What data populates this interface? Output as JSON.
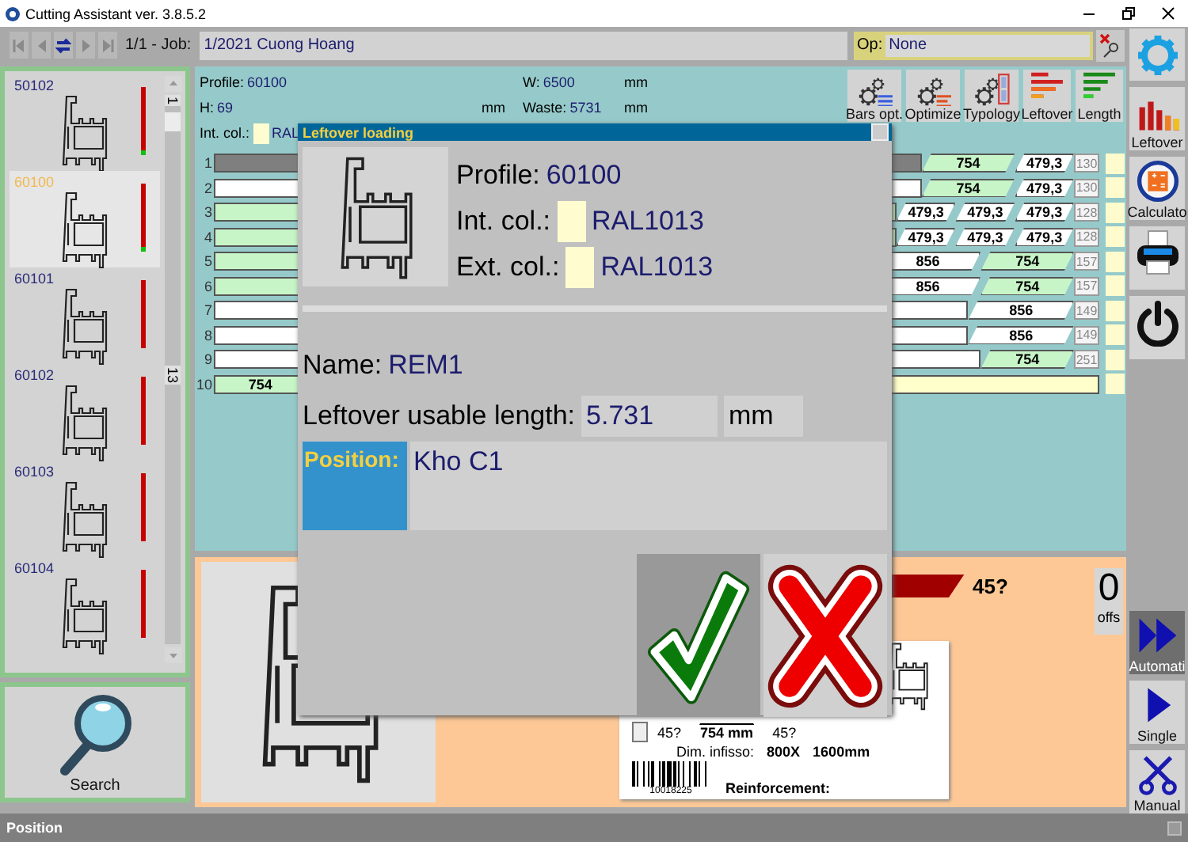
{
  "window": {
    "title": "Cutting Assistant ver. 3.8.5.2"
  },
  "toolbar": {
    "nav": [
      {
        "kind": "first",
        "disabled": true
      },
      {
        "kind": "prev",
        "disabled": true
      },
      {
        "kind": "swap",
        "disabled": false
      },
      {
        "kind": "next",
        "disabled": true
      },
      {
        "kind": "last",
        "disabled": true
      }
    ],
    "job_label": "1/1 - Job:",
    "job": "1/2021 Cuong Hoang",
    "op_label": "Op:",
    "op": "None"
  },
  "profiles": {
    "items": [
      {
        "code": "50102",
        "selected": false,
        "level": 0.06
      },
      {
        "code": "60100",
        "selected": true,
        "level": 0.06
      },
      {
        "code": "60101",
        "selected": false,
        "level": 0
      },
      {
        "code": "60102",
        "selected": false,
        "level": 0
      },
      {
        "code": "60103",
        "selected": false,
        "level": 0
      },
      {
        "code": "60104",
        "selected": false,
        "level": 0
      }
    ],
    "scroll_top_label": "1",
    "scroll_mid_label": "13",
    "search": "Search"
  },
  "bars": {
    "header": {
      "profile": {
        "label": "Profile:",
        "value": "60100"
      },
      "w": {
        "label": "W:",
        "value": "6500",
        "unit": "mm"
      },
      "h": {
        "label": "H:",
        "value": "69",
        "unit": "mm"
      },
      "waste": {
        "label": "Waste:",
        "value": "5731",
        "unit": "mm"
      },
      "int_col": {
        "label": "Int. col.:",
        "value": "RAL",
        "color": "#fffdd0"
      }
    },
    "tools": [
      {
        "kind": "bars",
        "label": "Bars opt."
      },
      {
        "kind": "optimize",
        "label": "Optimize"
      },
      {
        "kind": "typology",
        "label": "Typology"
      },
      {
        "kind": "leftover",
        "label": "Leftover"
      },
      {
        "kind": "length",
        "label": "Length"
      }
    ],
    "rows": [
      {
        "number": "1",
        "left": {
          "color": "#7f7f7f"
        },
        "pieces": [
          {
            "text": "754",
            "color": "#c8f5c8"
          },
          {
            "text": "479,3",
            "color": "#ffffff"
          }
        ],
        "rest": "130"
      },
      {
        "number": "2",
        "left": {
          "color": "#ffffff"
        },
        "pieces": [
          {
            "text": "754",
            "color": "#c8f5c8"
          },
          {
            "text": "479,3",
            "color": "#ffffff"
          }
        ],
        "rest": "130"
      },
      {
        "number": "3",
        "left": {
          "color": "#c8f5c8"
        },
        "pieces": [
          {
            "text": "479,3",
            "color": "#ffffff"
          },
          {
            "text": "479,3",
            "color": "#ffffff"
          },
          {
            "text": "479,3",
            "color": "#ffffff"
          }
        ],
        "rest": "128"
      },
      {
        "number": "4",
        "left": {
          "color": "#c8f5c8"
        },
        "pieces": [
          {
            "text": "479,3",
            "color": "#ffffff"
          },
          {
            "text": "479,3",
            "color": "#ffffff"
          },
          {
            "text": "479,3",
            "color": "#ffffff"
          }
        ],
        "rest": "128"
      },
      {
        "number": "5",
        "left": {
          "color": "#c8f5c8"
        },
        "pieces": [
          {
            "text": "856",
            "color": "#ffffff"
          },
          {
            "text": "754",
            "color": "#c8f5c8"
          }
        ],
        "rest": "157"
      },
      {
        "number": "6",
        "left": {
          "color": "#c8f5c8"
        },
        "pieces": [
          {
            "text": "856",
            "color": "#ffffff"
          },
          {
            "text": "754",
            "color": "#c8f5c8"
          }
        ],
        "rest": "157"
      },
      {
        "number": "7",
        "left": {
          "color": "#ffffff"
        },
        "pieces": [
          {
            "text": "856",
            "color": "#ffffff"
          }
        ],
        "rest": "149"
      },
      {
        "number": "8",
        "left": {
          "color": "#ffffff"
        },
        "pieces": [
          {
            "text": "856",
            "color": "#ffffff"
          }
        ],
        "rest": "149"
      },
      {
        "number": "9",
        "left": {
          "color": "#ffffff"
        },
        "pieces": [
          {
            "text": "754",
            "color": "#c8f5c8"
          }
        ],
        "rest": "251"
      },
      {
        "number": "10",
        "left": {
          "text": "754",
          "color": "#c8f5c8"
        },
        "pieces": [
          {
            "color": "#ffffcc"
          }
        ]
      }
    ]
  },
  "cut_view": {
    "angle": "45?",
    "counter": {
      "value": "0",
      "label": "offs"
    },
    "label_card": {
      "left_angle": "45?",
      "length": "754 mm",
      "right_angle": "45?",
      "dims_label": "Dim. infisso:",
      "width": "800X",
      "height": "1600mm",
      "barcode_number": "10018225",
      "reinforcement": "Reinforcement:"
    }
  },
  "side_tools": {
    "top": [
      {
        "kind": "settings"
      },
      {
        "kind": "chart",
        "label": "Leftover"
      },
      {
        "kind": "calculator",
        "label": "Calculato"
      },
      {
        "kind": "printer"
      },
      {
        "kind": "power"
      }
    ],
    "modes": [
      {
        "kind": "fast",
        "label": "Automati",
        "selected": true
      },
      {
        "kind": "play",
        "label": "Single",
        "selected": false
      },
      {
        "kind": "scissors",
        "label": "Manual",
        "selected": false
      }
    ]
  },
  "dialog": {
    "title": "Leftover loading",
    "profile": {
      "label": "Profile:",
      "value": "60100"
    },
    "int_col": {
      "label": "Int. col.:",
      "value": "RAL1013",
      "color": "#fffdd0"
    },
    "ext_col": {
      "label": "Ext. col.:",
      "value": "RAL1013",
      "color": "#fffdd0"
    },
    "name": {
      "label": "Name:",
      "value": "REM1"
    },
    "length": {
      "label": "Leftover usable length:",
      "value": "5.731",
      "unit": "mm"
    },
    "position": {
      "label": "Position:",
      "value": "Kho C1"
    },
    "buttons": [
      {
        "kind": "confirm",
        "focused": true
      },
      {
        "kind": "cancel",
        "focused": false
      }
    ]
  },
  "status_bar": {
    "text": "Position"
  }
}
